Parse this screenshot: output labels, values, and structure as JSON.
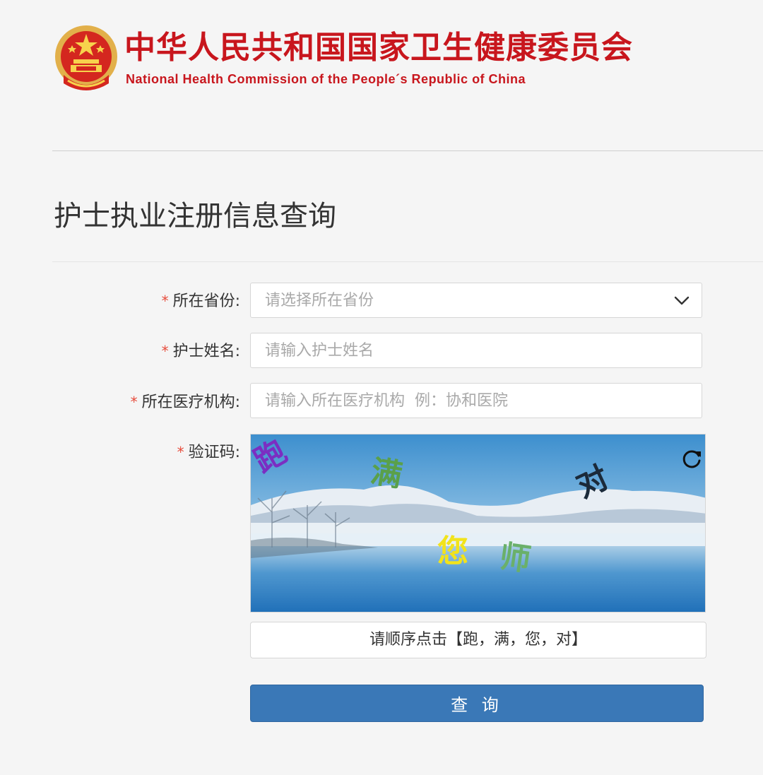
{
  "header": {
    "emblem_icon": "national-emblem-icon",
    "title_cn": "中华人民共和国国家卫生健康委员会",
    "title_en": "National Health Commission of the People´s Republic of China",
    "brand_color": "#c8161d"
  },
  "page": {
    "title": "护士执业注册信息查询"
  },
  "form": {
    "required_mark": "*",
    "province": {
      "label": "所在省份:",
      "placeholder": "请选择所在省份",
      "icon": "chevron-down-icon"
    },
    "name": {
      "label": "护士姓名:",
      "placeholder": "请输入护士姓名"
    },
    "institution": {
      "label": "所在医疗机构:",
      "placeholder": "请输入所在医疗机构  例：协和医院"
    },
    "captcha": {
      "label": "验证码:",
      "chars": [
        "跑",
        "满",
        "对",
        "您",
        "师"
      ],
      "refresh_icon": "refresh-icon",
      "hint": "请顺序点击【跑，满，您，对】"
    },
    "submit_label": "查 询",
    "accent_color": "#3a78b7"
  }
}
